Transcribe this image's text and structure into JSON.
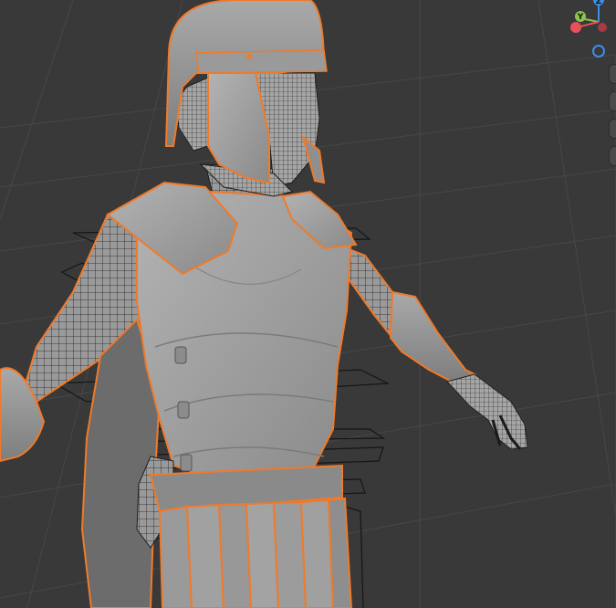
{
  "app": {
    "editor": "3D Viewport"
  },
  "viewport": {
    "background": "#393939",
    "grid_line_color": "#474747",
    "selection_outline_color": "#f07a2a",
    "mesh_color": "#9b9b9b",
    "wire_color": "#1e1e1e"
  },
  "navigation_gizmo": {
    "axes": [
      {
        "label": "Y",
        "color": "#8bc34a"
      },
      {
        "label": "Z",
        "color": "#3d8fe6"
      },
      {
        "label": "X",
        "color": "#e8505b"
      }
    ]
  },
  "side_controls": [
    "zoom-icon",
    "pan-icon",
    "camera-icon",
    "perspective-icon"
  ]
}
